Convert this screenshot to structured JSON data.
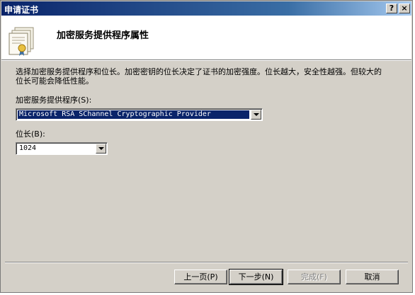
{
  "window": {
    "title": "申请证书",
    "help_label": "?",
    "close_label": "×"
  },
  "header": {
    "title": "加密服务提供程序属性",
    "icon": "certificate-icon"
  },
  "description": "选择加密服务提供程序和位长。加密密钥的位长决定了证书的加密强度。位长越大，安全性越强。但较大的位长可能会降低性能。",
  "csp": {
    "label": "加密服务提供程序(S):",
    "value": "Microsoft RSA SChannel Cryptographic Provider"
  },
  "bitlength": {
    "label": "位长(B):",
    "value": "1024"
  },
  "buttons": {
    "back": "上一页(P)",
    "next": "下一步(N)",
    "finish": "完成(F)",
    "cancel": "取消"
  }
}
